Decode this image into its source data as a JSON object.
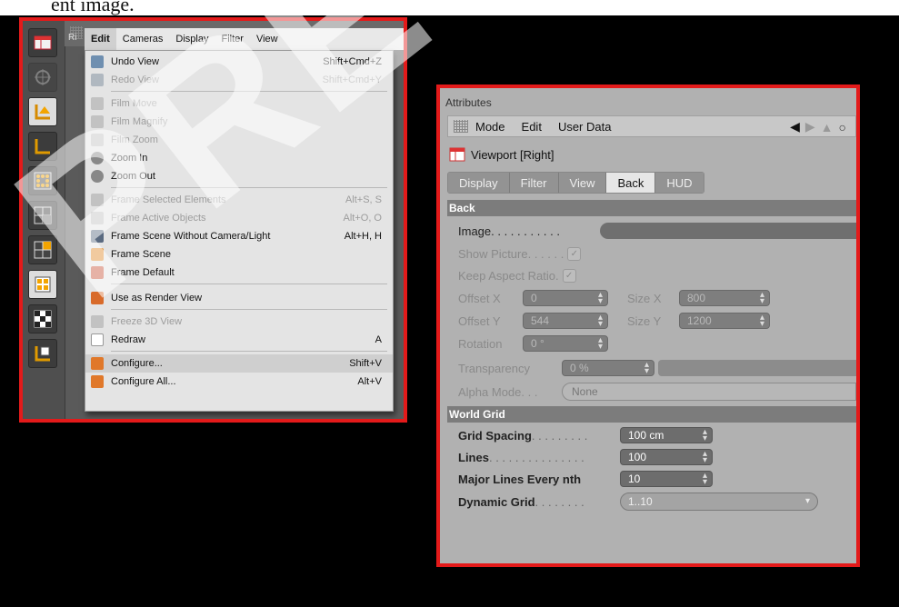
{
  "caption_fragment": "ent image.",
  "watermark": "PREVIEW",
  "left_panel": {
    "view_label": "Ri",
    "toolbar_icons": [
      "view-layout-icon",
      "move-icon",
      "axis-icon",
      "axis-alt-icon",
      "points-icon",
      "edges-icon",
      "polygons-icon",
      "model-icon",
      "texture-icon",
      "snap-icon"
    ],
    "menubar": [
      {
        "label": "Edit",
        "active": true
      },
      {
        "label": "Cameras",
        "active": false
      },
      {
        "label": "Display",
        "active": false
      },
      {
        "label": "Filter",
        "active": false
      },
      {
        "label": "View",
        "active": false
      }
    ],
    "menu_items": [
      {
        "label": "Undo View",
        "shortcut": "Shift+Cmd+Z",
        "disabled": false,
        "icon": "undo-view-icon"
      },
      {
        "label": "Redo View",
        "shortcut": "Shift+Cmd+Y",
        "disabled": true,
        "icon": "redo-view-icon"
      },
      {
        "label": "Film Move",
        "shortcut": "",
        "disabled": true,
        "icon": "film-move-icon"
      },
      {
        "label": "Film Magnify",
        "shortcut": "",
        "disabled": true,
        "icon": "film-magnify-icon"
      },
      {
        "label": "Film Zoom",
        "shortcut": "",
        "disabled": true,
        "icon": "film-zoom-icon"
      },
      {
        "label": "Zoom In",
        "shortcut": "",
        "disabled": false,
        "icon": "zoom-in-icon"
      },
      {
        "label": "Zoom Out",
        "shortcut": "",
        "disabled": false,
        "icon": "zoom-out-icon"
      },
      {
        "label": "Frame Selected Elements",
        "shortcut": "Alt+S, S",
        "disabled": true,
        "icon": "frame-selected-icon"
      },
      {
        "label": "Frame Active Objects",
        "shortcut": "Alt+O, O",
        "disabled": true,
        "icon": "frame-active-icon"
      },
      {
        "label": "Frame Scene Without Camera/Light",
        "shortcut": "Alt+H, H",
        "disabled": false,
        "icon": "frame-scene-nocam-icon"
      },
      {
        "label": "Frame Scene",
        "shortcut": "",
        "disabled": false,
        "icon": "frame-scene-icon"
      },
      {
        "label": "Frame Default",
        "shortcut": "",
        "disabled": false,
        "icon": "frame-default-icon"
      },
      {
        "label": "Use as Render View",
        "shortcut": "",
        "disabled": false,
        "icon": "render-view-icon"
      },
      {
        "label": "Freeze 3D View",
        "shortcut": "",
        "disabled": true,
        "icon": "freeze-view-icon"
      },
      {
        "label": "Redraw",
        "shortcut": "A",
        "disabled": false,
        "icon": "redraw-icon"
      },
      {
        "label": "Configure...",
        "shortcut": "Shift+V",
        "disabled": false,
        "highlighted": true,
        "icon": "configure-icon"
      },
      {
        "label": "Configure All...",
        "shortcut": "Alt+V",
        "disabled": false,
        "icon": "configure-all-icon"
      }
    ]
  },
  "right_panel": {
    "title": "Attributes",
    "menubar": [
      "Mode",
      "Edit",
      "User Data"
    ],
    "object_name": "Viewport [Right]",
    "tabs": [
      {
        "label": "Display",
        "active": false
      },
      {
        "label": "Filter",
        "active": false
      },
      {
        "label": "View",
        "active": false
      },
      {
        "label": "Back",
        "active": true
      },
      {
        "label": "HUD",
        "active": false
      }
    ],
    "back_section": {
      "title": "Back",
      "image_label": "Image",
      "image_dots": " . . . . . . . . . . .",
      "show_picture_label": "Show Picture",
      "show_picture_dots": " . . . . . .",
      "keep_aspect_label": "Keep Aspect Ratio",
      "keep_aspect_dots": " .",
      "offset_x_label": "Offset X",
      "offset_x_value": "0",
      "size_x_label": "Size X",
      "size_x_value": "800",
      "offset_y_label": "Offset Y",
      "offset_y_value": "544",
      "size_y_label": "Size Y",
      "size_y_value": "1200",
      "rotation_label": "Rotation",
      "rotation_value": "0 °",
      "transparency_label": "Transparency",
      "transparency_value": "0 %",
      "alpha_mode_label": "Alpha Mode",
      "alpha_mode_dots": " . . .",
      "alpha_mode_value": "None"
    },
    "world_grid": {
      "title": "World Grid",
      "grid_spacing_label": "Grid Spacing",
      "grid_spacing_dots": " . . . . . . . . .",
      "grid_spacing_value": "100 cm",
      "lines_label": "Lines",
      "lines_dots": " . . . . . . . . . . . . . . .",
      "lines_value": "100",
      "major_lines_label": "Major Lines Every nth",
      "major_lines_value": "10",
      "dynamic_grid_label": "Dynamic Grid",
      "dynamic_grid_dots": " . . . . . . . .",
      "dynamic_grid_value": "1..10"
    }
  }
}
